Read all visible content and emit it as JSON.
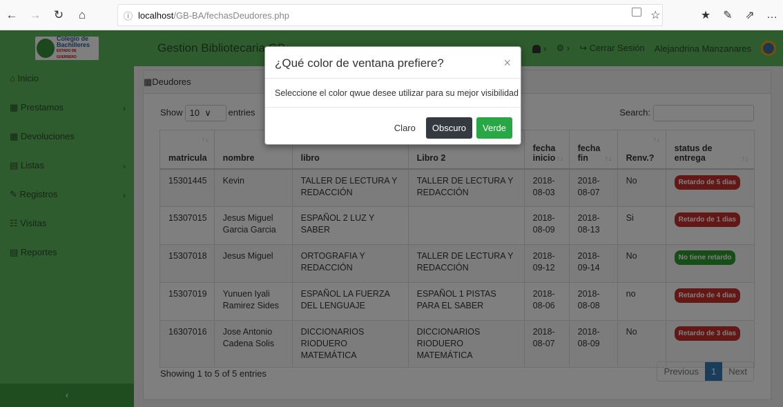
{
  "browser": {
    "back_icon": "←",
    "forward_icon": "→",
    "reload_icon": "↻",
    "home_icon": "⌂",
    "info_icon": "ⓘ",
    "url_host": "localhost",
    "url_path": "/GB-BA/fechasDeudores.php",
    "star_icon": "☆",
    "favorites_icon": "★",
    "pen_icon": "✎",
    "share_icon": "⇗",
    "more_icon": "…"
  },
  "nav": {
    "logo_line1": "Colegio de",
    "logo_line2": "Bachilleres",
    "logo_line3": "ESTADO DE GUERRERO",
    "title": "Gestion Bibliotecaria GB",
    "notif_caret": "›",
    "settings_icon": "⚙",
    "settings_caret": "›",
    "logout_icon": "↪",
    "logout": "Cerrar Sesión",
    "user": "Alejandrina Manzanares"
  },
  "sidebar": {
    "items": [
      {
        "icon": "⌂",
        "label": "Inicio",
        "chev": ""
      },
      {
        "icon": "▦",
        "label": "Prestamos",
        "chev": "›"
      },
      {
        "icon": "▦",
        "label": "Devoluciones",
        "chev": ""
      },
      {
        "icon": "▤",
        "label": "Listas",
        "chev": "›"
      },
      {
        "icon": "✎",
        "label": "Registros",
        "chev": "›"
      },
      {
        "icon": "☷",
        "label": "Visitas",
        "chev": ""
      },
      {
        "icon": "▤",
        "label": "Reportes",
        "chev": ""
      }
    ],
    "collapse": "‹"
  },
  "panel": {
    "icon": "▦",
    "title": "Deudores"
  },
  "table": {
    "show": "Show",
    "length": "10",
    "length_caret": "∨",
    "entries": "entries",
    "search": "Search:",
    "headers": [
      "matricula",
      "nombre",
      "libro",
      "Libro 2",
      "fecha inicio",
      "fecha fin",
      "Renv.?",
      "status de entrega"
    ],
    "rows": [
      {
        "matricula": "15301445",
        "nombre": "Kevin",
        "libro": "TALLER DE LECTURA Y REDACCIÓN",
        "libro2": "TALLER DE LECTURA Y REDACCIÓN",
        "inicio": "2018-08-03",
        "fin": "2018-08-07",
        "renv": "No",
        "status": "Retardo de 5 dias",
        "status_color": "#c9302c"
      },
      {
        "matricula": "15307015",
        "nombre": "Jesus Miguel Garcia Garcia",
        "libro": "ESPAÑOL 2 LUZ Y SABER",
        "libro2": "",
        "inicio": "2018-08-09",
        "fin": "2018-08-13",
        "renv": "Si",
        "status": "Retardo de 1 dias",
        "status_color": "#c9302c"
      },
      {
        "matricula": "15307018",
        "nombre": "Jesus Miguel",
        "libro": "ORTOGRAFIA Y REDACCIÓN",
        "libro2": "TALLER DE LECTURA Y REDACCIÓN",
        "inicio": "2018-09-12",
        "fin": "2018-09-14",
        "renv": "No",
        "status": "No tiene retardo",
        "status_color": "#2e9b2e"
      },
      {
        "matricula": "15307019",
        "nombre": "Yunuen Iyali Ramirez Sides",
        "libro": "ESPAÑOL LA FUERZA DEL LENGUAJE",
        "libro2": "ESPAÑOL 1 PISTAS PARA EL SABER",
        "inicio": "2018-08-06",
        "fin": "2018-08-08",
        "renv": "no",
        "status": "Retardo de 4 dias",
        "status_color": "#c9302c"
      },
      {
        "matricula": "16307016",
        "nombre": "Jose Antonio Cadena Solis",
        "libro": "DICCIONARIOS RIODUERO MATEMÁTICA",
        "libro2": "DICCIONARIOS RIODUERO MATEMÁTICA",
        "inicio": "2018-08-07",
        "fin": "2018-08-09",
        "renv": "No",
        "status": "Retardo de 3 dias",
        "status_color": "#c9302c"
      }
    ],
    "info": "Showing 1 to 5 of 5 entries",
    "prev": "Previous",
    "page": "1",
    "next": "Next"
  },
  "modal": {
    "title": "¿Qué color de ventana prefiere?",
    "close": "×",
    "body": "Seleccione el color qwue desee utilizar para su mejor visibilidad",
    "btn_light": "Claro",
    "btn_dark": "Obscuro",
    "btn_green": "Verde"
  },
  "colors": {
    "green": "#5cb85c",
    "dark_button": "#343a40",
    "green_button": "#28a745",
    "page_blue": "#337ab7",
    "late": "#c9302c",
    "ontime": "#2e9b2e"
  }
}
